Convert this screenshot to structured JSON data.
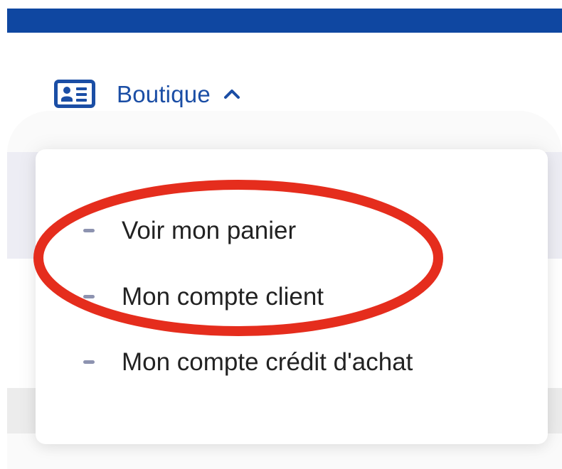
{
  "header": {
    "bar_color": "#0f47a1"
  },
  "nav": {
    "icon": "card-icon",
    "label": "Boutique",
    "chevron": "chevron-up-icon",
    "expanded": true
  },
  "menu": {
    "items": [
      {
        "label": "Voir mon panier"
      },
      {
        "label": "Mon compte client"
      },
      {
        "label": "Mon compte crédit d'achat"
      }
    ]
  },
  "annotation": {
    "shape": "ellipse",
    "color": "#e52d1d"
  }
}
